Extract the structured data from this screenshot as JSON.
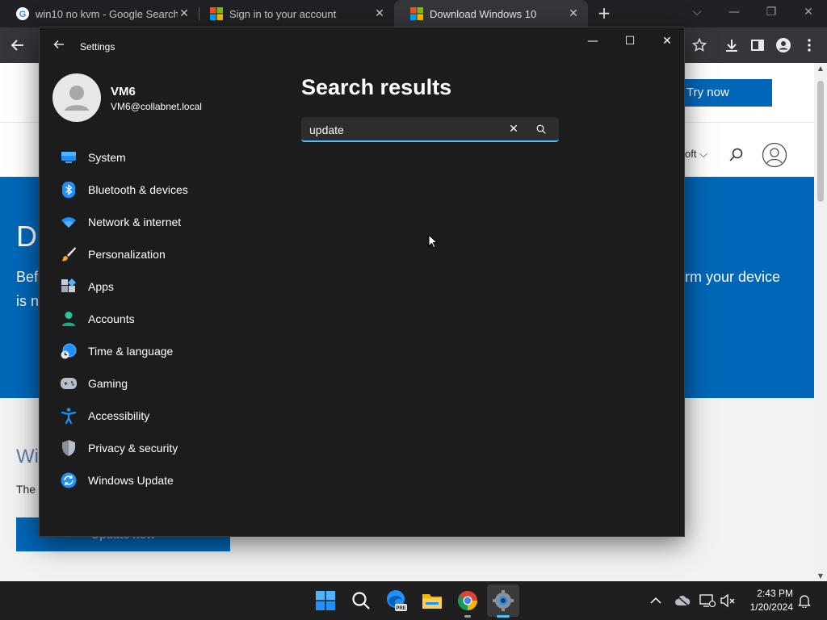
{
  "browser": {
    "tabs": [
      {
        "label": "win10 no kvm - Google Search",
        "close": "✕",
        "favicon": "google-icon"
      },
      {
        "label": "Sign in to your account",
        "close": "✕",
        "favicon": "microsoft-icon"
      },
      {
        "label": "Download Windows 10",
        "close": "✕",
        "favicon": "microsoft-icon"
      }
    ],
    "new_tab": "+",
    "accent": "#0067b8"
  },
  "webpage": {
    "try_now": "Try now",
    "nav_partial": "oft ⌵",
    "hero_heading_partial": "D",
    "hero_line1_partial": "Bef",
    "hero_line2_partial": "is n",
    "hero_right_partial": "rm your device",
    "section_heading_partial": "Wi",
    "section_text_partial": "The",
    "update_button": "Update now"
  },
  "settings": {
    "title": "Settings",
    "user": {
      "name": "VM6",
      "email": "VM6@collabnet.local"
    },
    "nav": [
      {
        "label": "System",
        "icon": "system-icon"
      },
      {
        "label": "Bluetooth & devices",
        "icon": "bluetooth-icon"
      },
      {
        "label": "Network & internet",
        "icon": "wifi-icon"
      },
      {
        "label": "Personalization",
        "icon": "brush-icon"
      },
      {
        "label": "Apps",
        "icon": "apps-icon"
      },
      {
        "label": "Accounts",
        "icon": "accounts-icon"
      },
      {
        "label": "Time & language",
        "icon": "time-language-icon"
      },
      {
        "label": "Gaming",
        "icon": "gaming-icon"
      },
      {
        "label": "Accessibility",
        "icon": "accessibility-icon"
      },
      {
        "label": "Privacy & security",
        "icon": "shield-icon"
      },
      {
        "label": "Windows Update",
        "icon": "windows-update-icon"
      }
    ],
    "results_title": "Search results",
    "search": {
      "value": "update"
    },
    "accent": "#4cc2ff"
  },
  "taskbar": {
    "time": "2:43 PM",
    "date": "1/20/2024"
  }
}
